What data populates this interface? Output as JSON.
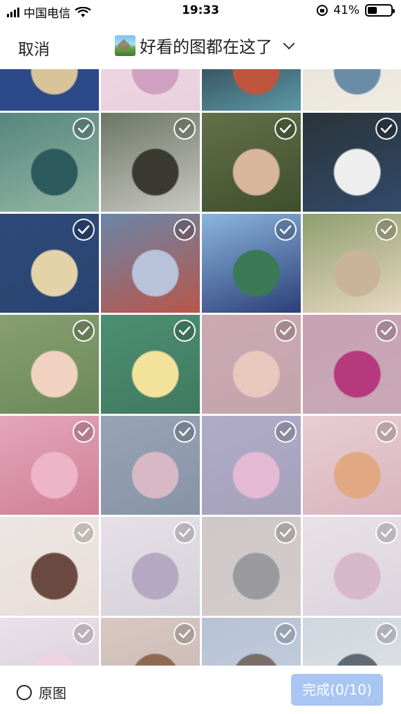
{
  "status_bar": {
    "carrier": "中国电信",
    "time": "19:33",
    "battery_percent": "41%",
    "battery_level": 0.41
  },
  "navbar": {
    "cancel_label": "取消",
    "album_title": "好看的图都在这了"
  },
  "grid": {
    "tiles": [
      {
        "name": "photo-tile-1",
        "colors": [
          "#2c4a8a",
          "#d9c49a",
          "#2c4a8a"
        ]
      },
      {
        "name": "photo-tile-2",
        "colors": [
          "#f1d8e4",
          "#cfa0c0",
          "#e8d0dc"
        ]
      },
      {
        "name": "photo-tile-3",
        "colors": [
          "#1d2630",
          "#c0553d",
          "#5d9aa8"
        ]
      },
      {
        "name": "photo-tile-4",
        "colors": [
          "#e7e3db",
          "#6b8ca6",
          "#efeae2"
        ]
      },
      {
        "name": "photo-tile-5",
        "colors": [
          "#55867c",
          "#2d5a5c",
          "#93b6a5"
        ]
      },
      {
        "name": "photo-tile-6",
        "colors": [
          "#6c7663",
          "#3a3a33",
          "#c9c8c4"
        ]
      },
      {
        "name": "photo-tile-7",
        "colors": [
          "#64704a",
          "#d8b69b",
          "#3f4f2c"
        ]
      },
      {
        "name": "photo-tile-8",
        "colors": [
          "#2a3438",
          "#eee",
          "#324a6a"
        ]
      },
      {
        "name": "photo-tile-9",
        "colors": [
          "#2e4a78",
          "#e4d3a8",
          "#2a4372"
        ]
      },
      {
        "name": "photo-tile-10",
        "colors": [
          "#6a86a8",
          "#b8c2d8",
          "#b8564b"
        ]
      },
      {
        "name": "photo-tile-11",
        "colors": [
          "#8bb6de",
          "#3a7a54",
          "#2c3f78"
        ]
      },
      {
        "name": "photo-tile-12",
        "colors": [
          "#8e9e6e",
          "#c9b49a",
          "#e8d8c2"
        ]
      },
      {
        "name": "photo-tile-13",
        "colors": [
          "#879e72",
          "#f1d2c0",
          "#6b8a58"
        ]
      },
      {
        "name": "photo-tile-14",
        "colors": [
          "#4d8f74",
          "#f2e29a",
          "#3f7a60"
        ]
      },
      {
        "name": "photo-tile-15",
        "colors": [
          "#caa9b2",
          "#e6c8bc",
          "#c5a5ad"
        ]
      },
      {
        "name": "photo-tile-16",
        "colors": [
          "#c8a2b2",
          "#b5397c",
          "#c9a8b6"
        ]
      },
      {
        "name": "photo-tile-17",
        "colors": [
          "#e3a6bb",
          "#eeb4c8",
          "#cf7f96"
        ]
      },
      {
        "name": "photo-tile-18",
        "colors": [
          "#98a2b6",
          "#d7b8c4",
          "#8794a6"
        ]
      },
      {
        "name": "photo-tile-19",
        "colors": [
          "#b0acc8",
          "#e4b9d4",
          "#a5a1bb"
        ]
      },
      {
        "name": "photo-tile-20",
        "colors": [
          "#e8ced2",
          "#e1a883",
          "#d8b4bf"
        ]
      },
      {
        "name": "photo-tile-21",
        "colors": [
          "#ede6e4",
          "#6a4a40",
          "#e8ddd8"
        ]
      },
      {
        "name": "photo-tile-22",
        "colors": [
          "#e6e0e8",
          "#b4a8c2",
          "#d6d0d8"
        ]
      },
      {
        "name": "photo-tile-23",
        "colors": [
          "#cfc8c8",
          "#9a9a9e",
          "#d4cccb"
        ]
      },
      {
        "name": "photo-tile-24",
        "colors": [
          "#e8e2e8",
          "#d7b8c8",
          "#dcd4dc"
        ]
      },
      {
        "name": "photo-tile-25",
        "colors": [
          "#e9e1ea",
          "#f0d3e0",
          "#d8cad4"
        ]
      },
      {
        "name": "photo-tile-26",
        "colors": [
          "#d8c7c2",
          "#8f6a52",
          "#c9b6b2"
        ]
      },
      {
        "name": "photo-tile-27",
        "colors": [
          "#b7c2d6",
          "#7a6f68",
          "#c7cfdf"
        ]
      },
      {
        "name": "photo-tile-28",
        "colors": [
          "#d0d6de",
          "#5f6b74",
          "#e1e4e8"
        ]
      }
    ]
  },
  "bottom_bar": {
    "original_label": "原图",
    "done_label": "完成(0/10)"
  }
}
